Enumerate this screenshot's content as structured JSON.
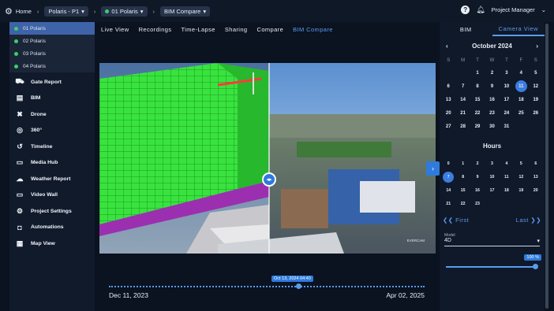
{
  "breadcrumb": {
    "home": "Home",
    "project": "Polaris - P1",
    "camera": "01 Polaris",
    "view": "BIM Compare"
  },
  "topright": {
    "help": "?",
    "user": "Project Manager"
  },
  "projects": [
    {
      "label": "01 Polaris",
      "active": true
    },
    {
      "label": "02 Polaris",
      "active": false
    },
    {
      "label": "03 Polaris",
      "active": false
    },
    {
      "label": "04 Polaris",
      "active": false
    }
  ],
  "nav": [
    {
      "label": "Gate Report",
      "icon": "truck-icon",
      "glyph": "⛟"
    },
    {
      "label": "BIM",
      "icon": "building-icon",
      "glyph": "▤"
    },
    {
      "label": "Drone",
      "icon": "drone-icon",
      "glyph": "✖"
    },
    {
      "label": "360°",
      "icon": "panorama-icon",
      "glyph": "◎"
    },
    {
      "label": "Timeline",
      "icon": "history-icon",
      "glyph": "↺"
    },
    {
      "label": "Media Hub",
      "icon": "media-icon",
      "glyph": "▭"
    },
    {
      "label": "Weather Report",
      "icon": "weather-icon",
      "glyph": "☁"
    },
    {
      "label": "Video Wall",
      "icon": "monitor-icon",
      "glyph": "▭"
    },
    {
      "label": "Project Settings",
      "icon": "gear-icon",
      "glyph": "⚙"
    },
    {
      "label": "Automations",
      "icon": "automation-icon",
      "glyph": "◘"
    },
    {
      "label": "Map View",
      "icon": "map-icon",
      "glyph": "▦"
    }
  ],
  "tabs": [
    {
      "label": "Live View",
      "selected": false
    },
    {
      "label": "Recordings",
      "selected": false
    },
    {
      "label": "Time-Lapse",
      "selected": false
    },
    {
      "label": "Sharing",
      "selected": false
    },
    {
      "label": "Compare",
      "selected": false
    },
    {
      "label": "BIM Compare",
      "selected": true
    }
  ],
  "viewer": {
    "watermark": "EVERCAM"
  },
  "timeline": {
    "start": "Dec 11, 2023",
    "end": "Apr 02, 2025",
    "current": "Oct 13, 2024 04:40",
    "position_fraction": 0.6
  },
  "right_tabs": [
    {
      "label": "BIM",
      "selected": false
    },
    {
      "label": "Camera View",
      "selected": true
    }
  ],
  "calendar": {
    "month": "October 2024",
    "weekdays": [
      "S",
      "M",
      "T",
      "W",
      "T",
      "F",
      "S"
    ],
    "leading_blanks": 2,
    "days": [
      "1",
      "2",
      "3",
      "4",
      "5",
      "6",
      "7",
      "8",
      "9",
      "10",
      "11",
      "12",
      "13",
      "14",
      "15",
      "16",
      "17",
      "18",
      "19",
      "20",
      "21",
      "22",
      "23",
      "24",
      "25",
      "26",
      "27",
      "28",
      "29",
      "30",
      "31"
    ],
    "selected_day": "11"
  },
  "hours": {
    "title": "Hours",
    "values": [
      "0",
      "1",
      "2",
      "3",
      "4",
      "5",
      "6",
      "7",
      "8",
      "9",
      "10",
      "11",
      "12",
      "13",
      "14",
      "15",
      "16",
      "17",
      "18",
      "19",
      "20",
      "21",
      "22",
      "23"
    ],
    "selected": "7"
  },
  "pager": {
    "first": "First",
    "last": "Last"
  },
  "model": {
    "label": "Model",
    "value": "4D"
  },
  "opacity": {
    "label": "100 %",
    "value_fraction": 1.0
  },
  "colors": {
    "accent": "#3b7de0",
    "bim_green": "#2ee83a"
  }
}
